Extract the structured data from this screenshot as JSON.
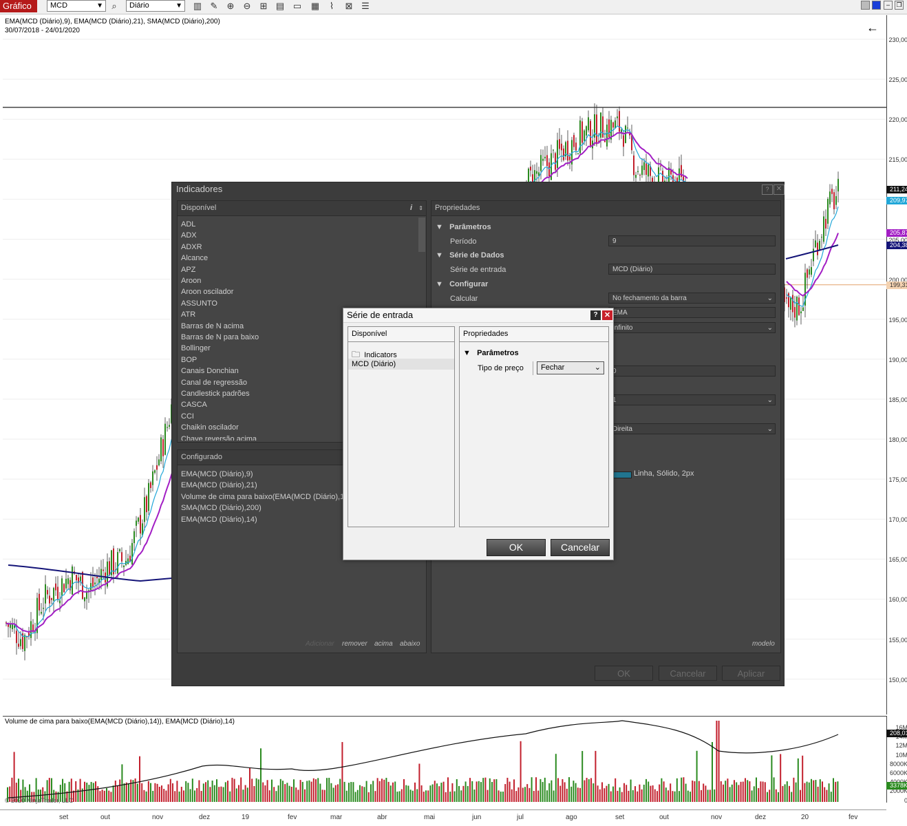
{
  "toolbar": {
    "app_title": "Gráfico",
    "instrument": "MCD",
    "timeframe": "Diário",
    "icons": [
      "search-icon",
      "bar-type-icon",
      "draw-icon",
      "zoom-in-icon",
      "zoom-out-icon",
      "crosshair-icon",
      "data-box-icon",
      "templates-icon",
      "properties-icon",
      "strategies-icon",
      "indicators-icon",
      "list-icon"
    ],
    "window_buttons": [
      "color-icon",
      "tile-icon",
      "minimize-icon",
      "restore-icon"
    ]
  },
  "chart": {
    "indicators_line": "EMA(MCD (Diário),9), EMA(MCD (Diário),21), SMA(MCD (Diário),200)",
    "date_range": "30/07/2018 - 24/01/2020",
    "volume_label": "Volume de cima para baixo(EMA(MCD (Diário),14)), EMA(MCD (Diário),14)",
    "copyright": "© 2020 NinjaTrader, LLC",
    "price_ticks": [
      "230,00",
      "225,00",
      "220,00",
      "215,00",
      "210,00",
      "205,00",
      "200,00",
      "195,00",
      "190,00",
      "185,00",
      "180,00",
      "175,00",
      "170,00",
      "165,00",
      "160,00",
      "155,00",
      "150,00"
    ],
    "volume_ticks": [
      "16M",
      "14M",
      "12M",
      "10M",
      "8000K",
      "6000K",
      "4000K",
      "2000K",
      "0"
    ],
    "x_ticks": [
      "set",
      "out",
      "nov",
      "dez",
      "19",
      "fev",
      "mar",
      "abr",
      "mai",
      "jun",
      "jul",
      "ago",
      "set",
      "out",
      "nov",
      "dez",
      "20",
      "fev"
    ],
    "price_tags": {
      "last": "211,24",
      "ema9": "209,97",
      "ema21": "205,87",
      "sma200": "204,38",
      "hline": "199,31",
      "volume": "208,01",
      "vol_ema": "3378K"
    },
    "colors": {
      "up": "#2a8a1f",
      "down": "#c21f2c",
      "ema9": "#21a7d8",
      "ema21": "#a21ec4",
      "sma200": "#141478",
      "hline": "#e2a06a"
    }
  },
  "indicators_dialog": {
    "title": "Indicadores",
    "available_header": "Disponível",
    "available_items": [
      "ADL",
      "ADX",
      "ADXR",
      "Alcance",
      "APZ",
      "Aroon",
      "Aroon oscilador",
      "ASSUNTO",
      "ATR",
      "Barras de N acima",
      "Barras de N para baixo",
      "Bollinger",
      "BOP",
      "Canais Donchian",
      "Canal de regressão",
      "Candlestick padrões",
      "CASCA",
      "CCI",
      "Chaikin oscilador",
      "Chave reversão acima"
    ],
    "configured_header": "Configurado",
    "configured_items": [
      "EMA(MCD (Diário),9)",
      "EMA(MCD (Diário),21)",
      "Volume de cima para baixo(EMA(MCD (Diário),14))",
      "SMA(MCD (Diário),200)",
      "EMA(MCD (Diário),14)"
    ],
    "links": [
      "Adicionar",
      "remover",
      "acima",
      "abaixo"
    ],
    "properties_header": "Propriedades",
    "sections": {
      "parameters": "Parâmetros",
      "data_series": "Série de Dados",
      "configure": "Configurar"
    },
    "period_label": "Período",
    "period_value": "9",
    "input_series_label": "Série de entrada",
    "input_series_value": "MCD (Diário)",
    "calculate_label": "Calcular",
    "calculate_value": "No fechamento da barra",
    "name_value": "EMA",
    "lookback_value": "Infinito",
    "field_value_2": "0",
    "field_value_3": "1",
    "field_value_4": "Direita",
    "plot_value": "Linha, Sólido, 2px",
    "template_link": "modelo",
    "buttons": {
      "ok": "OK",
      "cancel": "Cancelar",
      "apply": "Aplicar"
    }
  },
  "input_series_dialog": {
    "title": "Série de entrada",
    "available_header": "Disponível",
    "items": [
      "Indicators",
      "MCD (Diário)"
    ],
    "properties_header": "Propriedades",
    "parameters": "Parâmetros",
    "price_type_label": "Tipo de preço",
    "price_type_value": "Fechar",
    "ok": "OK",
    "cancel": "Cancelar"
  }
}
